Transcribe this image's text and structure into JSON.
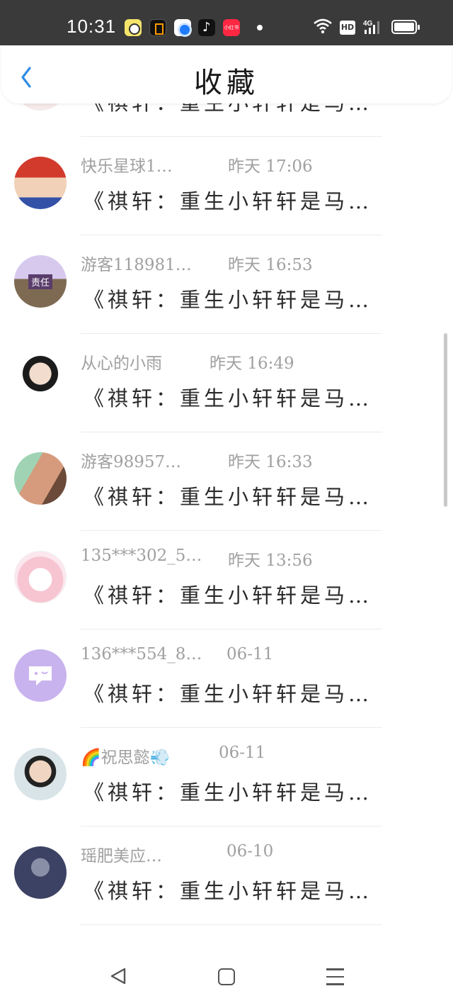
{
  "status_bar": {
    "time": "10:31",
    "hd_label": "HD",
    "network_label": "4G",
    "app_icons": [
      "qq-browser-icon",
      "notes-icon",
      "browser-icon",
      "douyin-icon",
      "xiaohongshu-icon"
    ],
    "xiaohongshu_label": "小红书"
  },
  "header": {
    "title": "收藏",
    "back_icon": "chevron-left-icon",
    "accent": "#2f8de4"
  },
  "list": {
    "rows": [
      {
        "user": "",
        "time": "",
        "title": "《祺轩：重生小轩轩是马…",
        "avatar_color": "#f6e9e9"
      },
      {
        "user": "快乐星球1…",
        "time": "昨天 17:06",
        "title": "《祺轩：重生小轩轩是马…",
        "avatar_color": "#c94a3a"
      },
      {
        "user": "游客118981…",
        "time": "昨天 16:53",
        "title": "《祺轩：重生小轩轩是马…",
        "avatar_color": "#8b7ba3",
        "avatar_text": "责任"
      },
      {
        "user": "从心的小雨",
        "time": "昨天 16:49",
        "title": "《祺轩：重生小轩轩是马…",
        "avatar_color": "#d9d9d9"
      },
      {
        "user": "游客98957…",
        "time": "昨天 16:33",
        "title": "《祺轩：重生小轩轩是马…",
        "avatar_color": "#c88a6e"
      },
      {
        "user": "135***302_5…",
        "time": "昨天 13:56",
        "title": "《祺轩：重生小轩轩是马…",
        "avatar_color": "#f9dde4"
      },
      {
        "user": "136***554_8…",
        "time": "06-11",
        "title": "《祺轩：重生小轩轩是马…",
        "avatar_color": "#c9b3ee"
      },
      {
        "user": "🌈祝思懿💨",
        "time": "06-11",
        "title": "《祺轩：重生小轩轩是马…",
        "avatar_color": "#b8c7cc"
      },
      {
        "user": "瑶肥美应…",
        "time": "06-10",
        "title": "《祺轩：重生小轩轩是马…",
        "avatar_color": "#3c4263"
      }
    ]
  },
  "nav_bar": {
    "icons": [
      "back-triangle-icon",
      "home-square-icon",
      "menu-lines-icon"
    ]
  }
}
